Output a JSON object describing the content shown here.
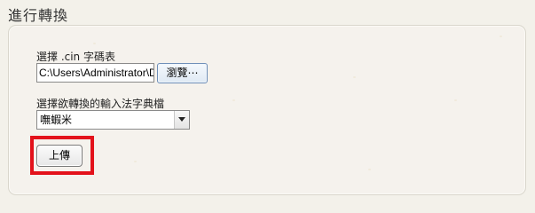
{
  "section": {
    "title": "進行轉換"
  },
  "form": {
    "cin_label": "選擇 .cin 字碼表",
    "file_path_value": "C:\\Users\\Administrator\\Dro",
    "browse_button_label": "瀏覽⋯",
    "dict_label": "選擇欲轉換的輸入法字典檔",
    "dict_selected": "嘸蝦米",
    "upload_button_label": "上傳"
  },
  "colors": {
    "highlight": "#e3121b",
    "browse_border": "#6f8fb8"
  }
}
